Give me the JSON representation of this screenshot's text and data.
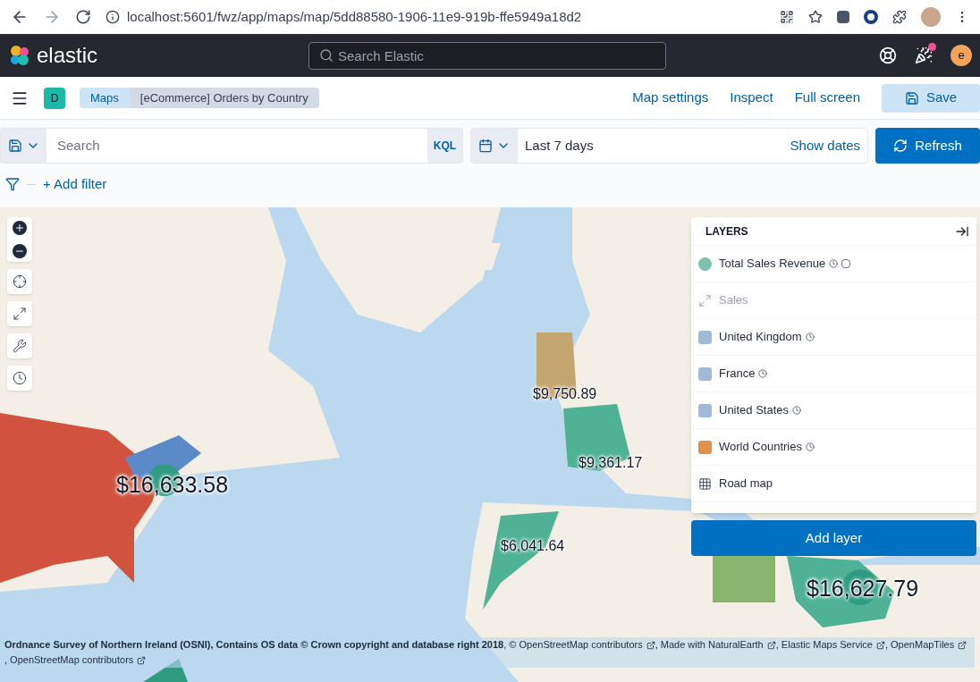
{
  "browser": {
    "url": "localhost:5601/fwz/app/maps/map/5dd88580-1906-11e9-919b-ffe5949a18d2"
  },
  "header": {
    "logo": "elastic",
    "search_placeholder": "Search Elastic",
    "avatar": "e"
  },
  "nav": {
    "space": "D",
    "breadcrumbs": [
      {
        "label": "Maps",
        "selected": false
      },
      {
        "label": "[eCommerce] Orders by Country",
        "selected": true
      }
    ],
    "links": [
      "Map settings",
      "Inspect",
      "Full screen"
    ],
    "save": "Save"
  },
  "query": {
    "placeholder": "Search",
    "language": "KQL",
    "time": "Last 7 days",
    "show_dates": "Show dates",
    "refresh": "Refresh",
    "add_filter": "+ Add filter"
  },
  "map_labels": [
    "$9,750.89",
    "$9,361.17",
    "$16,633.58",
    "$6,041.64",
    "$16,627.79"
  ],
  "layers": {
    "title": "LAYERS",
    "items": [
      {
        "name": "Total Sales Revenue",
        "kind": "circle",
        "color": "#7fc0ac",
        "disabled": false,
        "clock": true
      },
      {
        "name": "Sales",
        "kind": "resize",
        "disabled": true,
        "clock": false
      },
      {
        "name": "United Kingdom",
        "kind": "square",
        "color": "#a0b9d6",
        "disabled": false,
        "clock": true
      },
      {
        "name": "France",
        "kind": "square",
        "color": "#a0b9d6",
        "disabled": false,
        "clock": true
      },
      {
        "name": "United States",
        "kind": "square",
        "color": "#a0b9d6",
        "disabled": false,
        "clock": true
      },
      {
        "name": "World Countries",
        "kind": "square",
        "color": "#e0924c",
        "disabled": false,
        "clock": true
      },
      {
        "name": "Road map",
        "kind": "tiles",
        "disabled": false,
        "clock": false
      }
    ],
    "add": "Add layer"
  },
  "attribution": {
    "main": "Ordnance Survey of Northern Ireland (OSNI), Contains OS data © Crown copyright and database right 2018",
    "links": [
      ", © OpenStreetMap contributors",
      ", Made with NaturalEarth",
      ", Elastic Maps Service",
      ", OpenMapTiles",
      ", OpenStreetMap contributors"
    ]
  }
}
